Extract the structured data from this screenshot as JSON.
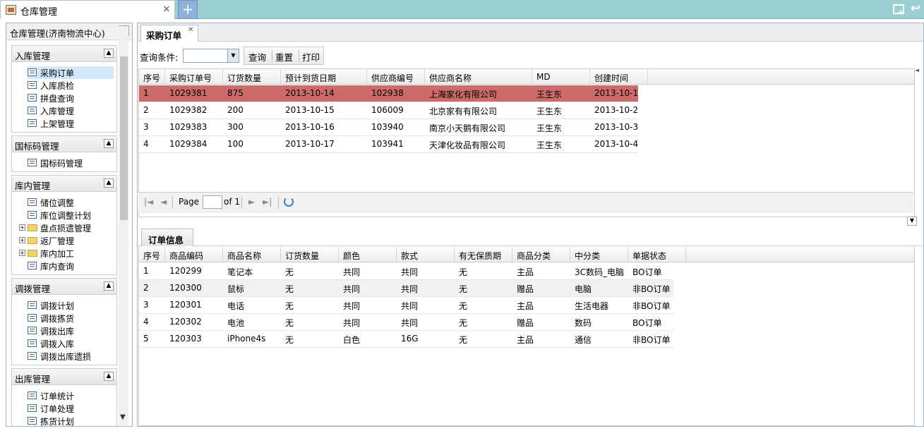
{
  "window": {
    "tab_label": "仓库管理",
    "tab_close": "×",
    "add_tab": "+"
  },
  "left_panel": {
    "title": "仓库管理(济南物流中心)",
    "collapse": "«",
    "groups": [
      {
        "title": "入库管理",
        "items": [
          {
            "label": "采购订单",
            "type": "item",
            "selected": true
          },
          {
            "label": "入库质检",
            "type": "item"
          },
          {
            "label": "拼盘查询",
            "type": "item"
          },
          {
            "label": "入库管理",
            "type": "item"
          },
          {
            "label": "上架管理",
            "type": "item"
          }
        ]
      },
      {
        "title": "国标码管理",
        "items": [
          {
            "label": "国标码管理",
            "type": "item"
          }
        ]
      },
      {
        "title": "库内管理",
        "items": [
          {
            "label": "储位调整",
            "type": "item"
          },
          {
            "label": "库位调整计划",
            "type": "item"
          },
          {
            "label": "盘点损遗管理",
            "type": "folder"
          },
          {
            "label": "返厂管理",
            "type": "folder"
          },
          {
            "label": "库内加工",
            "type": "folder"
          },
          {
            "label": "库内查询",
            "type": "item"
          }
        ]
      },
      {
        "title": "调拨管理",
        "items": [
          {
            "label": "调拨计划",
            "type": "item"
          },
          {
            "label": "调拨拣货",
            "type": "item"
          },
          {
            "label": "调拨出库",
            "type": "item"
          },
          {
            "label": "调拨入库",
            "type": "item"
          },
          {
            "label": "调拨出库遗损",
            "type": "item"
          }
        ]
      },
      {
        "title": "出库管理",
        "items": [
          {
            "label": "订单统计",
            "type": "item"
          },
          {
            "label": "订单处理",
            "type": "item"
          },
          {
            "label": "拣货计划",
            "type": "item"
          }
        ]
      }
    ]
  },
  "main": {
    "tab_label": "采购订单",
    "toolbar": {
      "query_label": "查询条件:",
      "query_button": "查询",
      "reset_button": "重置",
      "print_button": "打印"
    },
    "order_grid": {
      "columns": [
        "序号",
        "采购订单号",
        "订货数量",
        "预计到货日期",
        "供应商编号",
        "供应商名称",
        "MD",
        "创建时间"
      ],
      "rows": [
        [
          "1",
          "1029381",
          "875",
          "2013-10-14",
          "102938",
          "上海家化有限公司",
          "王生东",
          "2013-10-1"
        ],
        [
          "2",
          "1029382",
          "200",
          "2013-10-15",
          "106009",
          "北京家有有限公司",
          "王生东",
          "2013-10-2"
        ],
        [
          "3",
          "1029383",
          "300",
          "2013-10-16",
          "103940",
          "南京小天鹅有限公司",
          "王生东",
          "2013-10-3"
        ],
        [
          "4",
          "1029384",
          "100",
          "2013-10-17",
          "103941",
          "天津化妆品有限公司",
          "王生东",
          "2013-10-4"
        ]
      ]
    },
    "pager": {
      "page_label": "Page",
      "of_label": "of 1",
      "page_value": ""
    },
    "detail": {
      "tab_label": "订单信息",
      "columns": [
        "序号",
        "商品编码",
        "商品名称",
        "订货数量",
        "颜色",
        "款式",
        "有无保质期",
        "商品分类",
        "中分类",
        "单据状态"
      ],
      "rows": [
        [
          "1",
          "120299",
          "笔记本",
          "无",
          "共同",
          "共同",
          "无",
          "主品",
          "3C数码_电脑",
          "BO订单"
        ],
        [
          "2",
          "120300",
          "鼠标",
          "无",
          "共同",
          "共同",
          "无",
          "赠品",
          "电脑",
          "非BO订单"
        ],
        [
          "3",
          "120301",
          "电话",
          "无",
          "共同",
          "共同",
          "无",
          "主品",
          "生活电器",
          "非BO订单"
        ],
        [
          "4",
          "120302",
          "电池",
          "无",
          "共同",
          "共同",
          "无",
          "赠品",
          "数码",
          "BO订单"
        ],
        [
          "5",
          "120303",
          "iPhone4s",
          "无",
          "白色",
          "16G",
          "无",
          "主品",
          "通信",
          "非BO订单"
        ]
      ]
    }
  },
  "colors": {
    "selected_row": "#cd6a6a",
    "top_bar": "#9bd0d2",
    "menu_selected": "#d3e7fb"
  }
}
